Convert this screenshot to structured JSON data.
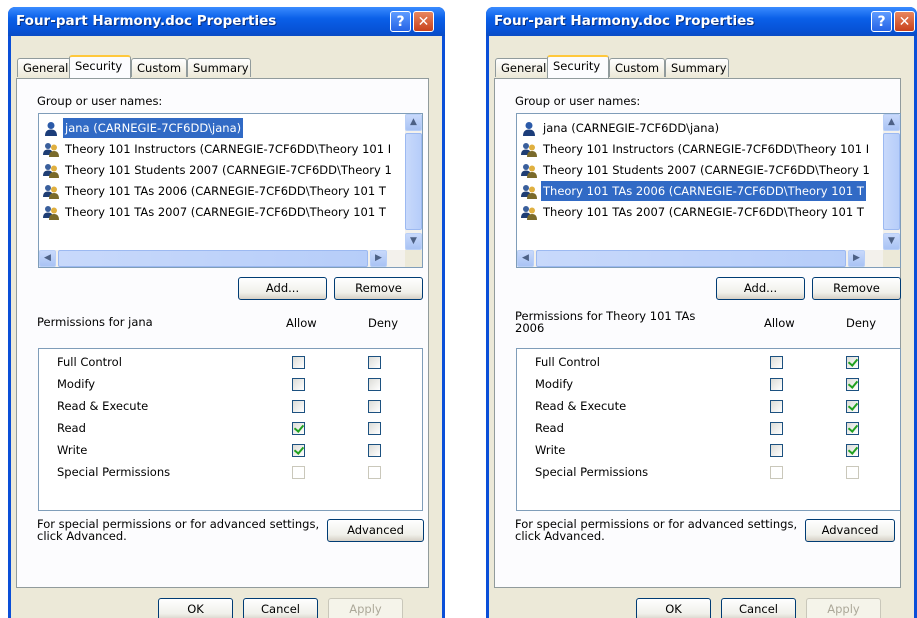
{
  "dialogs": [
    {
      "title": "Four-part Harmony.doc Properties",
      "tabs": [
        "General",
        "Security",
        "Custom",
        "Summary"
      ],
      "active_tab": "Security",
      "group_label": "Group or user names:",
      "users": [
        {
          "name": "jana (CARNEGIE-7CF6DD\\jana)",
          "icon": "single-user-icon",
          "selected": true
        },
        {
          "name": "Theory 101 Instructors (CARNEGIE-7CF6DD\\Theory 101 I",
          "icon": "group-users-icon",
          "selected": false
        },
        {
          "name": "Theory 101 Students 2007 (CARNEGIE-7CF6DD\\Theory 1",
          "icon": "group-users-icon",
          "selected": false
        },
        {
          "name": "Theory 101 TAs 2006 (CARNEGIE-7CF6DD\\Theory 101 T",
          "icon": "group-users-icon",
          "selected": false
        },
        {
          "name": "Theory 101 TAs 2007 (CARNEGIE-7CF6DD\\Theory 101 T",
          "icon": "group-users-icon",
          "selected": false
        }
      ],
      "add_label": "Add...",
      "remove_label": "Remove",
      "permissions_label": "Permissions for jana",
      "allow_label": "Allow",
      "deny_label": "Deny",
      "permissions": [
        {
          "name": "Full Control",
          "allow": false,
          "deny": false,
          "disabled": false
        },
        {
          "name": "Modify",
          "allow": false,
          "deny": false,
          "disabled": false
        },
        {
          "name": "Read & Execute",
          "allow": false,
          "deny": false,
          "disabled": false
        },
        {
          "name": "Read",
          "allow": true,
          "deny": false,
          "disabled": false
        },
        {
          "name": "Write",
          "allow": true,
          "deny": false,
          "disabled": false
        },
        {
          "name": "Special Permissions",
          "allow": false,
          "deny": false,
          "disabled": true
        }
      ],
      "advanced_text": "For special permissions or for advanced settings,\nclick Advanced.",
      "advanced_label": "Advanced",
      "ok_label": "OK",
      "cancel_label": "Cancel",
      "apply_label": "Apply"
    },
    {
      "title": "Four-part Harmony.doc Properties",
      "tabs": [
        "General",
        "Security",
        "Custom",
        "Summary"
      ],
      "active_tab": "Security",
      "group_label": "Group or user names:",
      "users": [
        {
          "name": "jana (CARNEGIE-7CF6DD\\jana)",
          "icon": "single-user-icon",
          "selected": false
        },
        {
          "name": "Theory 101 Instructors (CARNEGIE-7CF6DD\\Theory 101 I",
          "icon": "group-users-icon",
          "selected": false
        },
        {
          "name": "Theory 101 Students 2007 (CARNEGIE-7CF6DD\\Theory 1",
          "icon": "group-users-icon",
          "selected": false
        },
        {
          "name": "Theory 101 TAs 2006 (CARNEGIE-7CF6DD\\Theory 101 T",
          "icon": "group-users-icon",
          "selected": true
        },
        {
          "name": "Theory 101 TAs 2007 (CARNEGIE-7CF6DD\\Theory 101 T",
          "icon": "group-users-icon",
          "selected": false
        }
      ],
      "add_label": "Add...",
      "remove_label": "Remove",
      "permissions_label": "Permissions for Theory 101 TAs\n2006",
      "allow_label": "Allow",
      "deny_label": "Deny",
      "permissions": [
        {
          "name": "Full Control",
          "allow": false,
          "deny": true,
          "disabled": false
        },
        {
          "name": "Modify",
          "allow": false,
          "deny": true,
          "disabled": false
        },
        {
          "name": "Read & Execute",
          "allow": false,
          "deny": true,
          "disabled": false
        },
        {
          "name": "Read",
          "allow": false,
          "deny": true,
          "disabled": false
        },
        {
          "name": "Write",
          "allow": false,
          "deny": true,
          "disabled": false
        },
        {
          "name": "Special Permissions",
          "allow": false,
          "deny": false,
          "disabled": true
        }
      ],
      "advanced_text": "For special permissions or for advanced settings,\nclick Advanced.",
      "advanced_label": "Advanced",
      "ok_label": "OK",
      "cancel_label": "Cancel",
      "apply_label": "Apply"
    }
  ]
}
